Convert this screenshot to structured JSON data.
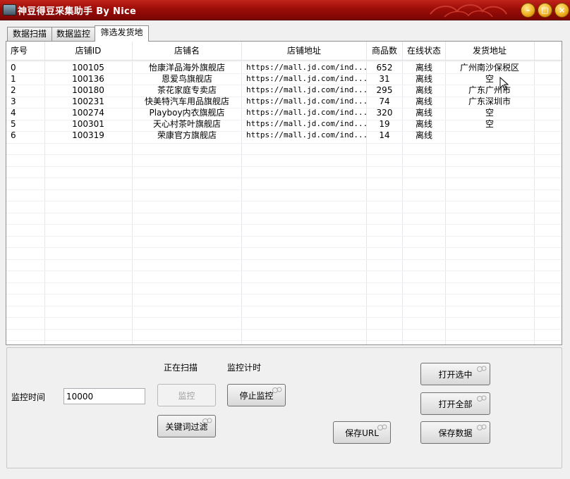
{
  "window": {
    "title": "神豆得豆采集助手   By Nice"
  },
  "tabs": [
    "数据扫描",
    "数据监控",
    "筛选发货地"
  ],
  "table": {
    "columns": [
      "序号",
      "店铺ID",
      "店铺名",
      "店铺地址",
      "商品数",
      "在线状态",
      "发货地址"
    ],
    "rows": [
      [
        "0",
        "100105",
        "怡康洋品海外旗舰店",
        "https://mall.jd.com/ind...",
        "652",
        "离线",
        "广州南沙保税区"
      ],
      [
        "1",
        "100136",
        "恩爱鸟旗舰店",
        "https://mall.jd.com/ind...",
        "31",
        "离线",
        "空"
      ],
      [
        "2",
        "100180",
        "茶花家庭专卖店",
        "https://mall.jd.com/ind...",
        "295",
        "离线",
        "广东广州市"
      ],
      [
        "3",
        "100231",
        "快美特汽车用品旗舰店",
        "https://mall.jd.com/ind...",
        "74",
        "离线",
        "广东深圳市"
      ],
      [
        "4",
        "100274",
        "Playboy内衣旗舰店",
        "https://mall.jd.com/ind...",
        "320",
        "离线",
        "空"
      ],
      [
        "5",
        "100301",
        "天心村茶叶旗舰店",
        "https://mall.jd.com/ind...",
        "19",
        "离线",
        "空"
      ],
      [
        "6",
        "100319",
        "荣康官方旗舰店",
        "https://mall.jd.com/ind...",
        "14",
        "离线",
        ""
      ]
    ]
  },
  "controls": {
    "scan_status": "正在扫描",
    "monitor_timer": "监控计时",
    "monitor_time_label": "监控时间",
    "monitor_time_value": "10000",
    "monitor_button": "监控",
    "stop_monitor_button": "停止监控",
    "keyword_filter_button": "关键词过滤",
    "save_url_button": "保存URL",
    "open_selected_button": "打开选中",
    "open_all_button": "打开全部",
    "save_data_button": "保存数据"
  },
  "colors": {
    "titlebar": "#9c0d08",
    "window_button": "#f0b020"
  }
}
